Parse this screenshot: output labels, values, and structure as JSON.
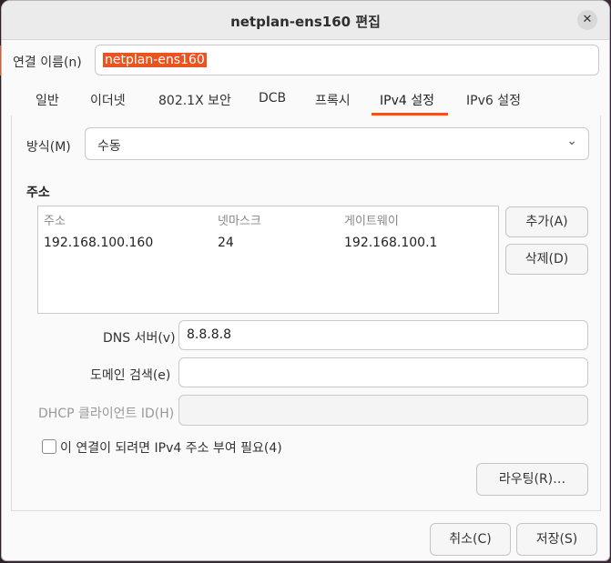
{
  "window": {
    "title": "netplan-ens160 편집",
    "close_icon": "close-icon"
  },
  "connection_name": {
    "label": "연결 이름(n)",
    "value": "netplan-ens160"
  },
  "tabs": [
    {
      "label": "일반"
    },
    {
      "label": "이더넷"
    },
    {
      "label": "802.1X 보안"
    },
    {
      "label": "DCB"
    },
    {
      "label": "프록시"
    },
    {
      "label": "IPv4 설정",
      "active": true
    },
    {
      "label": "IPv6 설정"
    }
  ],
  "method": {
    "label": "방식(M)",
    "value": "수동"
  },
  "addresses": {
    "section_title": "주소",
    "columns": [
      "주소",
      "넷마스크",
      "게이트웨이"
    ],
    "rows": [
      [
        "192.168.100.160",
        "24",
        "192.168.100.1"
      ]
    ],
    "add_button": "추가(A)",
    "delete_button": "삭제(D)"
  },
  "dns": {
    "label": "DNS 서버(v)",
    "value": "8.8.8.8"
  },
  "search_domains": {
    "label": "도메인 검색(e)",
    "value": ""
  },
  "dhcp_client_id": {
    "label": "DHCP 클라이언트 ID(H)",
    "value": ""
  },
  "require_ipv4": {
    "label": "이 연결이 되려면 IPv4 주소 부여 필요(4)",
    "checked": false
  },
  "routes_button": "라우팅(R)…",
  "footer": {
    "cancel": "취소(C)",
    "save": "저장(S)"
  },
  "colors": {
    "accent": "#e95420"
  }
}
